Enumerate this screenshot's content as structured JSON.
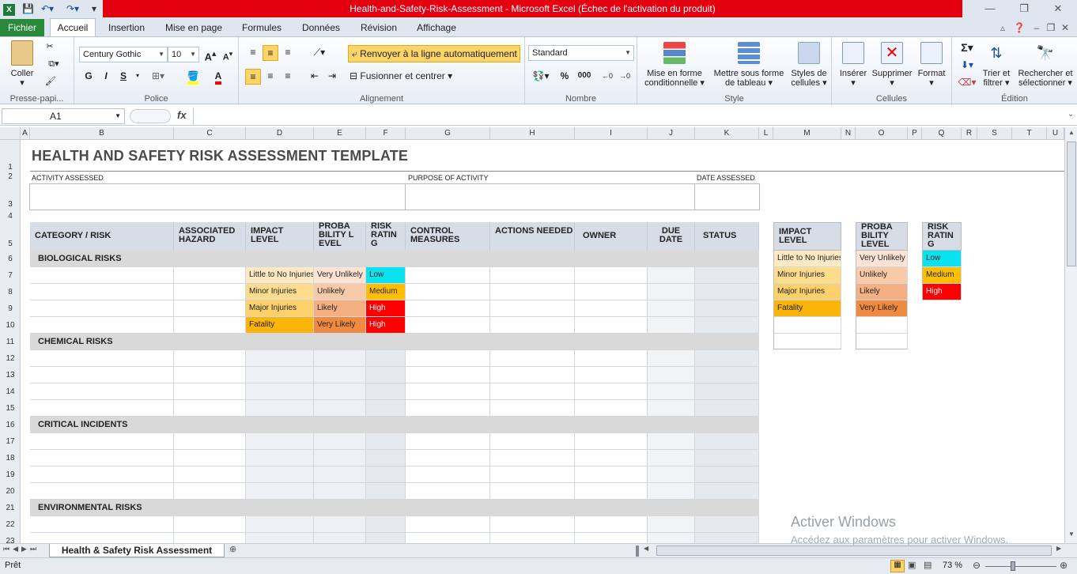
{
  "window": {
    "title": "Health-and-Safety-Risk-Assessment  -  Microsoft Excel (Échec de l'activation du produit)"
  },
  "tabs": {
    "file": "Fichier",
    "items": [
      "Accueil",
      "Insertion",
      "Mise en page",
      "Formules",
      "Données",
      "Révision",
      "Affichage"
    ]
  },
  "ribbon": {
    "clipboard": {
      "paste": "Coller",
      "group": "Presse-papi..."
    },
    "font": {
      "name": "Century Gothic",
      "size": "10",
      "bold": "G",
      "italic": "I",
      "underline": "S",
      "group": "Police"
    },
    "alignment": {
      "wrap": "Renvoyer à la ligne automatiquement",
      "merge": "Fusionner et centrer",
      "group": "Alignement"
    },
    "number": {
      "format": "Standard",
      "percent": "%",
      "thousands": "000",
      "group": "Nombre"
    },
    "styles": {
      "conditional": "Mise en forme conditionnelle",
      "table": "Mettre sous forme de tableau",
      "cellstyles": "Styles de cellules",
      "group": "Style"
    },
    "cells": {
      "insert": "Insérer",
      "delete": "Supprimer",
      "format": "Format",
      "group": "Cellules"
    },
    "editing": {
      "sum": "Σ",
      "sort": "Trier et filtrer",
      "find": "Rechercher et sélectionner",
      "group": "Édition"
    }
  },
  "formula_bar": {
    "namebox": "A1",
    "fx": "fx",
    "value": ""
  },
  "columns": [
    "A",
    "B",
    "C",
    "D",
    "E",
    "F",
    "G",
    "H",
    "I",
    "J",
    "K",
    "L",
    "M",
    "N",
    "O",
    "P",
    "Q",
    "R",
    "S",
    "T",
    "U"
  ],
  "rows": [
    "1",
    "2",
    "3",
    "4",
    "5",
    "6",
    "7",
    "8",
    "9",
    "10",
    "11",
    "12",
    "13",
    "14",
    "15",
    "16",
    "17",
    "18",
    "19",
    "20",
    "21",
    "22",
    "23"
  ],
  "sheet": {
    "title": "HEALTH AND SAFETY RISK ASSESSMENT TEMPLATE",
    "activity_label": "ACTIVITY ASSESSED",
    "purpose_label": "PURPOSE OF ACTIVITY",
    "date_label": "DATE ASSESSED",
    "headers": [
      "CATEGORY / RISK",
      "ASSOCIATED HAZARD",
      "IMPACT LEVEL",
      "PROBABILITY LEVEL",
      "RISK RATING",
      "CONTROL MEASURES",
      "ACTIONS NEEDED",
      "OWNER",
      "DUE DATE",
      "STATUS"
    ],
    "categories": [
      "BIOLOGICAL RISKS",
      "CHEMICAL RISKS",
      "CRITICAL INCIDENTS",
      "ENVIRONMENTAL RISKS"
    ],
    "bio_rows": [
      {
        "impact": "Little to No Injuries",
        "prob": "Very Unlikely",
        "risk": "Low"
      },
      {
        "impact": "Minor Injuries",
        "prob": "Unlikely",
        "risk": "Medium"
      },
      {
        "impact": "Major Injuries",
        "prob": "Likely",
        "risk": "High"
      },
      {
        "impact": "Fatality",
        "prob": "Very Likely",
        "risk": "High"
      }
    ],
    "legend": {
      "impact_header": "IMPACT LEVEL",
      "prob_header": "PROBABILITY LEVEL",
      "risk_header": "RISK RATING",
      "impact": [
        "Little to No Injuries",
        "Minor Injuries",
        "Major Injuries",
        "Fatality"
      ],
      "prob": [
        "Very Unlikely",
        "Unlikely",
        "Likely",
        "Very Likely"
      ],
      "risk": [
        "Low",
        "Medium",
        "High"
      ]
    }
  },
  "sheet_tab": "Health & Safety Risk Assessment",
  "status": {
    "ready": "Prêt",
    "zoom": "73 %"
  },
  "watermark": {
    "line1": "Activer Windows",
    "line2": "Accédez aux paramètres pour activer Windows."
  },
  "colors": {
    "impact1": "#fde9c3",
    "impact2": "#fddc8e",
    "impact3": "#fcd16b",
    "impact4": "#fbb40a",
    "prob1": "#fce3d3",
    "prob2": "#f8caa7",
    "prob3": "#f4b082",
    "prob4": "#ef8a40",
    "low": "#0ae3ef",
    "medium": "#ffbf00",
    "high": "#ff0000",
    "file": "#2a8a3b",
    "titlered": "#e3000f"
  }
}
